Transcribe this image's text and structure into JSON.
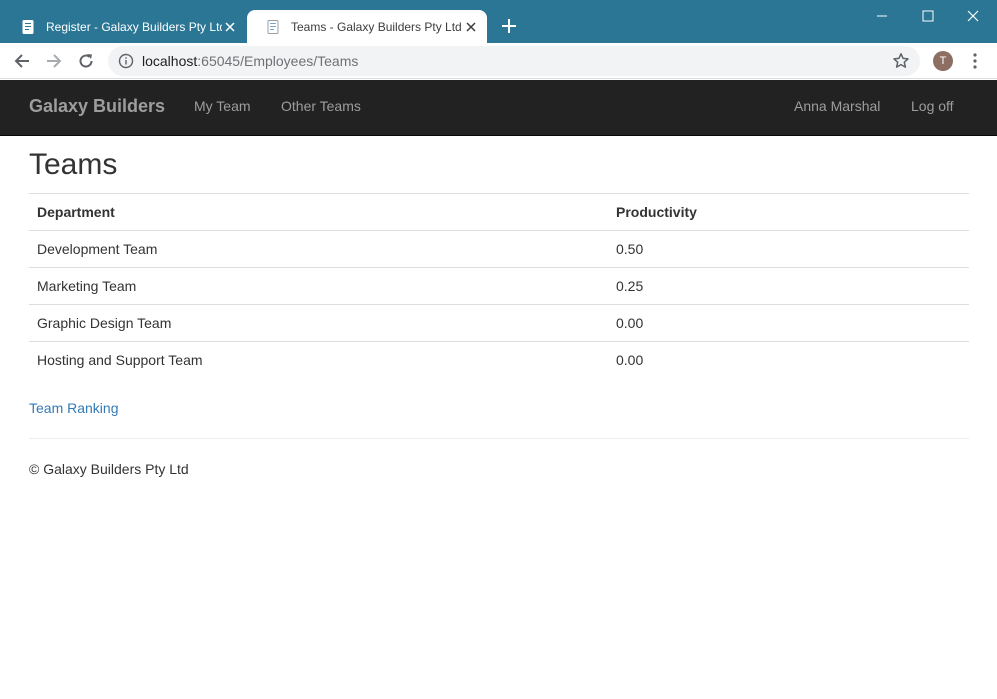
{
  "browser": {
    "tabs": [
      {
        "title": "Register - Galaxy Builders Pty Ltd",
        "icon": "page-icon",
        "active": false
      },
      {
        "title": "Teams - Galaxy Builders Pty Ltd",
        "icon": "page-icon",
        "active": true
      }
    ],
    "address": {
      "host": "localhost",
      "path": ":65045/Employees/Teams"
    },
    "profile_initial": "T",
    "colors": {
      "tab_strip": "#2a7694",
      "profile_avatar": "#8d6e63"
    }
  },
  "navbar": {
    "brand": "Galaxy Builders",
    "left_links": [
      "My Team",
      "Other Teams"
    ],
    "user_name": "Anna Marshal",
    "logoff": "Log off",
    "colors": {
      "background": "#222222",
      "link": "#9d9d9d"
    }
  },
  "page": {
    "title": "Teams",
    "table": {
      "headers": [
        "Department",
        "Productivity"
      ],
      "rows": [
        [
          "Development Team",
          "0.50"
        ],
        [
          "Marketing Team",
          "0.25"
        ],
        [
          "Graphic Design Team",
          "0.00"
        ],
        [
          "Hosting and Support Team",
          "0.00"
        ]
      ]
    },
    "ranking_link": "Team Ranking",
    "link_color": "#337ab7"
  },
  "footer": {
    "text": "© Galaxy Builders Pty Ltd"
  }
}
